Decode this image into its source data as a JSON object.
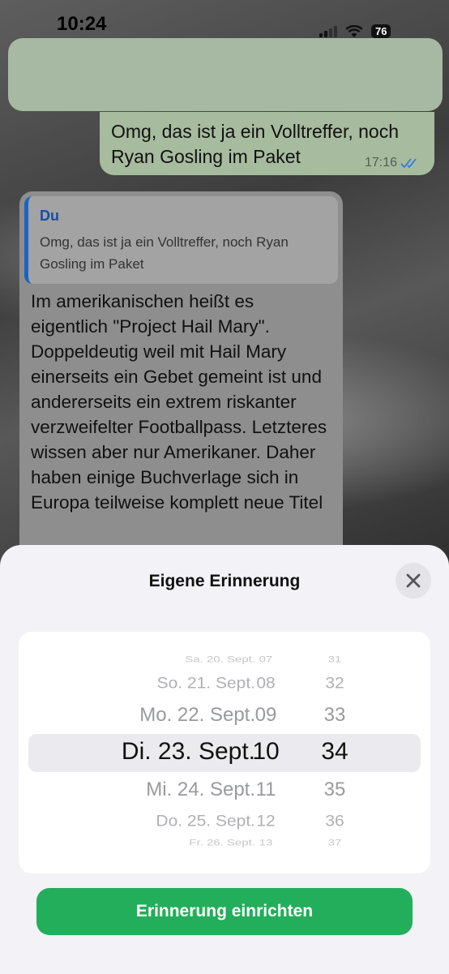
{
  "status_bar": {
    "time": "10:24",
    "battery": "76"
  },
  "chat": {
    "outgoing": {
      "text": "Omg, das ist ja ein Volltreffer, noch Ryan Gosling im Paket",
      "time": "17:16"
    },
    "incoming": {
      "quote_author": "Du",
      "quote_text": "Omg, das ist ja ein Volltreffer, noch Ryan Gosling im Paket",
      "text": "Im amerikanischen heißt es eigentlich \"Project Hail Mary\". Doppeldeutig weil mit Hail Mary einerseits ein Gebet gemeint ist und andererseits ein extrem riskanter verzweifelter Footballpass. Letzteres wissen aber nur Amerikaner. Daher haben einige Buchverlage sich in Europa teilweise komplett neue Titel"
    }
  },
  "sheet": {
    "title": "Eigene Erinnerung",
    "button_label": "Erinnerung einrichten",
    "picker": {
      "dates": [
        "Sa. 20. Sept.",
        "So. 21. Sept.",
        "Mo. 22. Sept.",
        "Di. 23. Sept.",
        "Mi. 24. Sept.",
        "Do. 25. Sept.",
        "Fr. 26. Sept."
      ],
      "hours": [
        "07",
        "08",
        "09",
        "10",
        "11",
        "12",
        "13"
      ],
      "minutes": [
        "31",
        "32",
        "33",
        "34",
        "35",
        "36",
        "37"
      ],
      "selected_date": "Di. 23. Sept.",
      "selected_hour": "10",
      "selected_minute": "34"
    }
  },
  "colors": {
    "accent_green": "#22ae5a",
    "quote_blue": "#1b63c5",
    "tick_blue": "#2f7be3"
  }
}
